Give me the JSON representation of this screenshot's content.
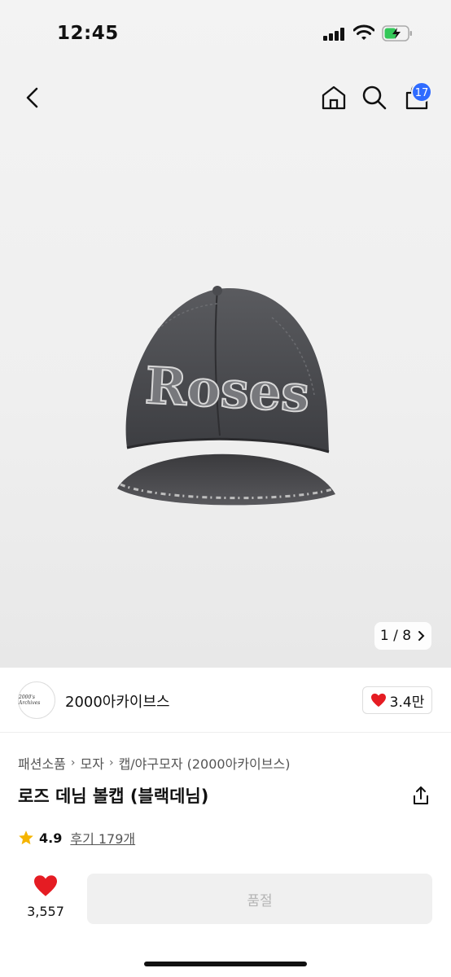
{
  "status_bar": {
    "time": "12:45",
    "battery_state": "charging",
    "signal_bars": 4
  },
  "nav": {
    "cart_badge": "17"
  },
  "gallery": {
    "page_indicator": "1 / 8",
    "current_page": 1,
    "total_pages": 8,
    "image_text": "Roses"
  },
  "brand": {
    "name": "2000아카이브스",
    "like_count": "3.4만",
    "logo_text": "2000's Archives"
  },
  "breadcrumb": {
    "items": [
      "패션소품",
      "모자",
      "캡/야구모자 (2000아카이브스)"
    ]
  },
  "product": {
    "title": "로즈 데님 볼캡 (블랙데님)",
    "rating": "4.9",
    "review_label": "후기 179개"
  },
  "bottom_bar": {
    "wish_count": "3,557",
    "soldout_label": "품절"
  },
  "colors": {
    "accent_blue": "#2f6bff",
    "heart_red": "#e51c23",
    "star_yellow": "#f5b400",
    "soldout_bg": "#f0f0f0"
  }
}
